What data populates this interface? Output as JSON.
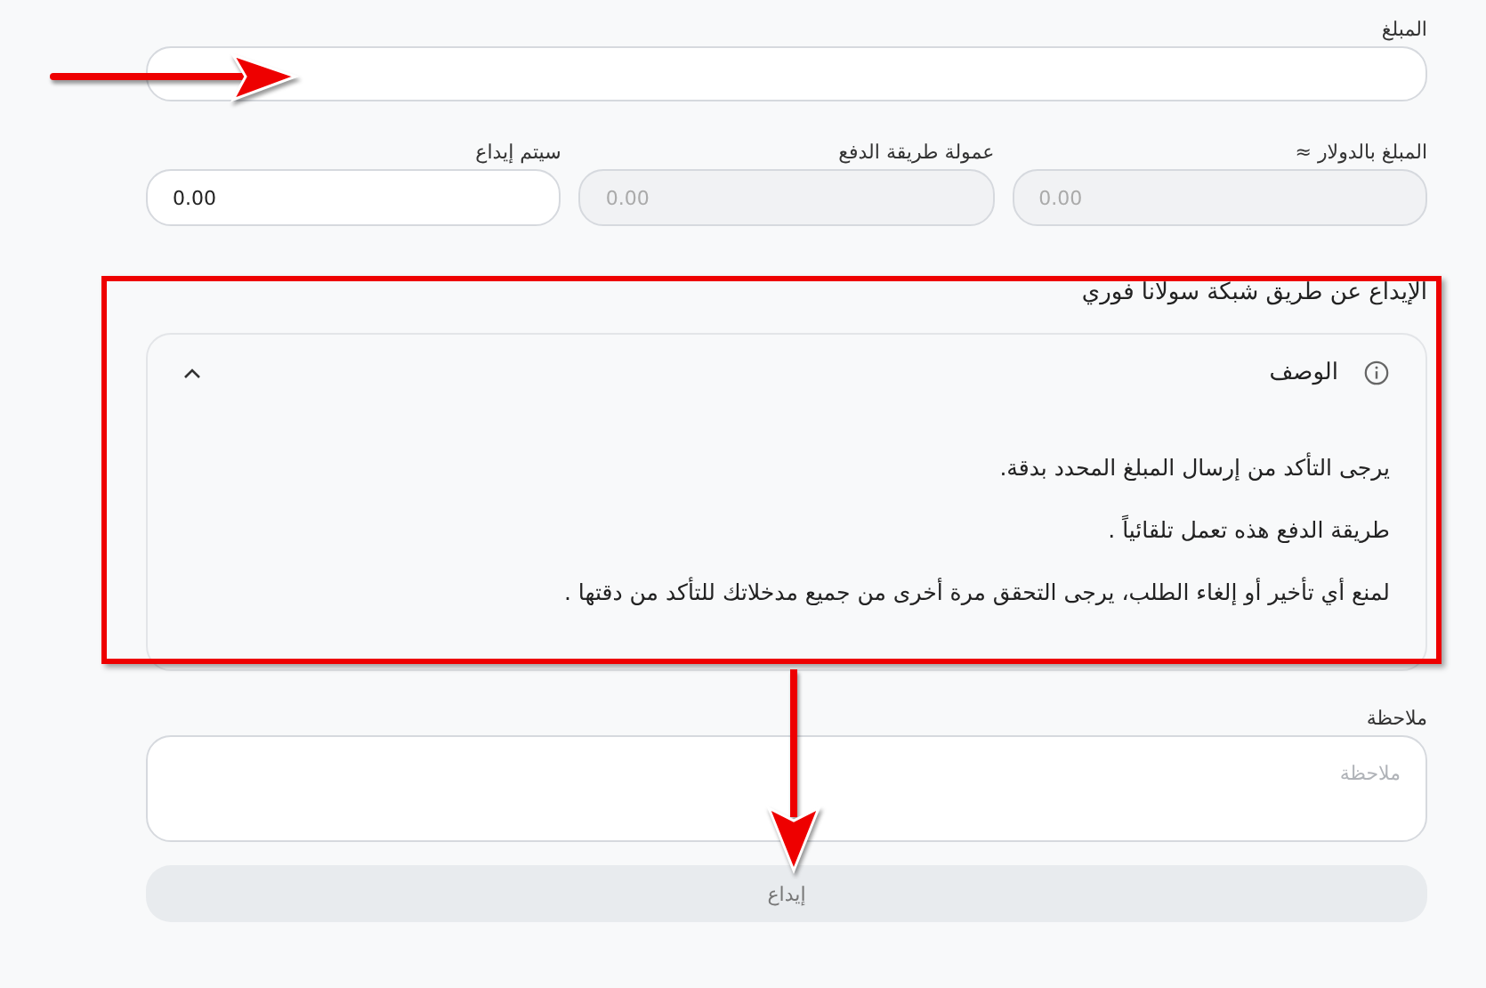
{
  "amount": {
    "label": "المبلغ"
  },
  "fields": [
    {
      "label": "المبلغ بالدولار ≈",
      "value": "0.00",
      "disabled": true
    },
    {
      "label": "عمولة طريقة الدفع",
      "value": "0.00",
      "disabled": true
    },
    {
      "label": "سيتم إيداع",
      "value": "0.00",
      "disabled": false
    }
  ],
  "section_title": "الإيداع عن طريق شبكة سولانا فوري",
  "accordion": {
    "title": "الوصف",
    "expanded": true,
    "lines": [
      "يرجى التأكد من إرسال المبلغ المحدد بدقة.",
      "طريقة الدفع هذه تعمل تلقائياً .",
      "لمنع أي تأخير أو إلغاء الطلب، يرجى التحقق مرة أخرى من جميع مدخلاتك للتأكد من دقتها ."
    ]
  },
  "note": {
    "label": "ملاحظة",
    "placeholder": "ملاحظة"
  },
  "submit": {
    "label": "إيداع",
    "disabled": true
  },
  "annotations": [
    {
      "kind": "arrow-right"
    },
    {
      "kind": "box"
    },
    {
      "kind": "arrow-down"
    }
  ]
}
